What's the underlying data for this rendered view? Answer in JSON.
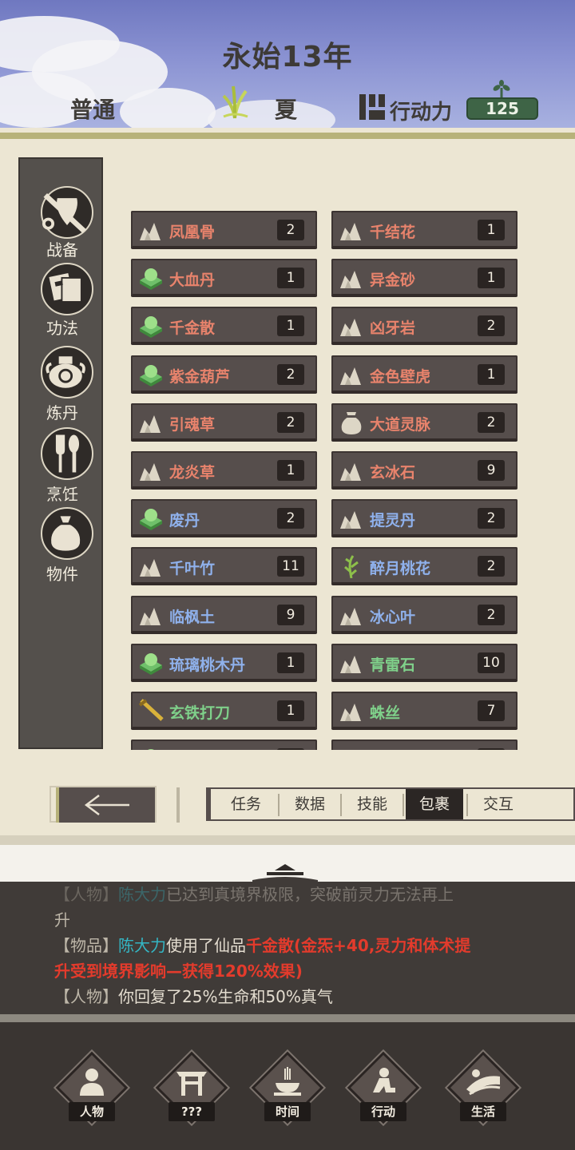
{
  "header": {
    "year_title": "永始13年",
    "difficulty": "普通",
    "season": "夏",
    "action_points_label": "行动力",
    "action_points_value": "125"
  },
  "sidebar": {
    "items": [
      {
        "label": "战备",
        "icon": "sword-shield-icon"
      },
      {
        "label": "功法",
        "icon": "scroll-book-icon"
      },
      {
        "label": "炼丹",
        "icon": "alchemy-cauldron-icon"
      },
      {
        "label": "烹饪",
        "icon": "cooking-utensils-icon"
      },
      {
        "label": "物件",
        "icon": "sack-bag-icon"
      }
    ]
  },
  "inventory": {
    "items": [
      {
        "name": "凤凰骨",
        "count": "2",
        "icon": "herb-icon",
        "color": "#e8836c"
      },
      {
        "name": "千结花",
        "count": "1",
        "icon": "herb-icon",
        "color": "#e8836c"
      },
      {
        "name": "大血丹",
        "count": "1",
        "icon": "pill-icon",
        "color": "#e8836c"
      },
      {
        "name": "异金砂",
        "count": "1",
        "icon": "herb-icon",
        "color": "#e8836c"
      },
      {
        "name": "千金散",
        "count": "1",
        "icon": "pill-icon",
        "color": "#e8836c"
      },
      {
        "name": "凶牙岩",
        "count": "2",
        "icon": "herb-icon",
        "color": "#e8836c"
      },
      {
        "name": "紫金葫芦",
        "count": "2",
        "icon": "pill-icon",
        "color": "#e8836c"
      },
      {
        "name": "金色壁虎",
        "count": "1",
        "icon": "herb-icon",
        "color": "#e8836c"
      },
      {
        "name": "引魂草",
        "count": "2",
        "icon": "herb-icon",
        "color": "#e8836c"
      },
      {
        "name": "大道灵脉",
        "count": "2",
        "icon": "bag-icon",
        "color": "#e8836c"
      },
      {
        "name": "龙炎草",
        "count": "1",
        "icon": "herb-icon",
        "color": "#e8836c"
      },
      {
        "name": "玄冰石",
        "count": "9",
        "icon": "herb-icon",
        "color": "#e8836c"
      },
      {
        "name": "废丹",
        "count": "2",
        "icon": "pill-icon",
        "color": "#8fb1ec"
      },
      {
        "name": "提灵丹",
        "count": "2",
        "icon": "herb-icon",
        "color": "#8fb1ec"
      },
      {
        "name": "千叶竹",
        "count": "11",
        "icon": "herb-icon",
        "color": "#8fb1ec"
      },
      {
        "name": "醉月桃花",
        "count": "2",
        "icon": "grass-icon",
        "color": "#8fb1ec"
      },
      {
        "name": "临枫土",
        "count": "9",
        "icon": "herb-icon",
        "color": "#8fb1ec"
      },
      {
        "name": "冰心叶",
        "count": "2",
        "icon": "herb-icon",
        "color": "#8fb1ec"
      },
      {
        "name": "琉璃桃木丹",
        "count": "1",
        "icon": "pill-icon",
        "color": "#8fb1ec"
      },
      {
        "name": "青雷石",
        "count": "10",
        "icon": "herb-icon",
        "color": "#7fd08a"
      },
      {
        "name": "玄铁打刀",
        "count": "1",
        "icon": "blade-icon",
        "color": "#7fd08a"
      },
      {
        "name": "蛛丝",
        "count": "7",
        "icon": "herb-icon",
        "color": "#7fd08a"
      },
      {
        "name": "",
        "count": "",
        "icon": "pill-icon",
        "color": "#7fd08a"
      },
      {
        "name": "",
        "count": "",
        "icon": "herb-icon",
        "color": "#7fd08a"
      }
    ]
  },
  "tabs": {
    "back_label": "←",
    "items": [
      "任务",
      "数据",
      "技能",
      "包裹",
      "交互"
    ],
    "active": "包裹"
  },
  "log": {
    "line0_tag": "【人物】",
    "line0_name": "陈大力",
    "line0_text": "已达到真境界极限，突破前灵力无法再上",
    "line1_text": "升",
    "line2_tag": "【物品】",
    "line2_name": "陈大力",
    "line2_mid": "使用了仙品",
    "line2_item": "千金散",
    "line2_effect": "(金炁+40,灵力和体术提",
    "line3_effect": "升受到境界影响—获得120%效果)",
    "line4_tag": "【人物】",
    "line4_text": "你回复了25%生命和50%真气"
  },
  "bottom_nav": [
    {
      "label": "人物",
      "icon": "person-icon"
    },
    {
      "label": "???",
      "icon": "gate-icon"
    },
    {
      "label": "时间",
      "icon": "incense-icon"
    },
    {
      "label": "行动",
      "icon": "action-person-icon"
    },
    {
      "label": "生活",
      "icon": "field-icon"
    }
  ]
}
